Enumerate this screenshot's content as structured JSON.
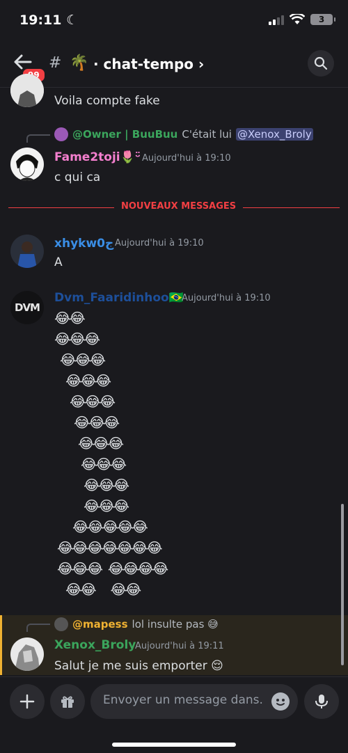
{
  "status_bar": {
    "time": "19:11",
    "battery": "3"
  },
  "header": {
    "badge": "99",
    "hash": "#",
    "channel_emoji": "🌴",
    "channel_name": "· chat-tempo ›"
  },
  "messages": {
    "m0": {
      "text": "Voila compte fake"
    },
    "m1": {
      "reply_author": "@Owner | BuuBuu",
      "reply_text": "C'était lui",
      "reply_mention": "@Xenox_Broly",
      "author": "Fame2toji🌷ᵕ̈",
      "time": "Aujourd'hui à 19:10",
      "text": "c qui ca"
    },
    "divider": "NOUVEAUX MESSAGES",
    "m2": {
      "author": "xhykw0ج",
      "time": "Aujourd'hui à 19:10",
      "text": "A"
    },
    "m3": {
      "author": "Dvm_Faaridinhoo🇧🇷",
      "time": "Aujourd'hui à 19:10",
      "avatar_text": "DVM",
      "lines": [
        "😂😂",
        "😂😂😂",
        "😂😂😂",
        "😂😂😂",
        "😂😂😂",
        "😂😂😂",
        "😂😂😂",
        "😂😂😂",
        "😂😂😂",
        "😂😂😂",
        "😂😂😂😂😂",
        "😂😂😂😂😂😂😂",
        "😂😂😂  😂😂😂😂",
        "😂😂     😂😂"
      ]
    },
    "m4": {
      "reply_author": "@mapess",
      "reply_text": "lol insulte pas 😅",
      "author": "Xenox_Broly",
      "time": "Aujourd'hui à 19:11",
      "text": "Salut je me suis emporter 😌"
    }
  },
  "composer": {
    "placeholder": "Envoyer un message dans..."
  },
  "colors": {
    "fame": "#f47fce",
    "owner": "#3ba55c",
    "xhy": "#3a8ee6",
    "dvm": "#1d4f9a",
    "xenox": "#3ba55c",
    "mapess": "#f0b232"
  }
}
